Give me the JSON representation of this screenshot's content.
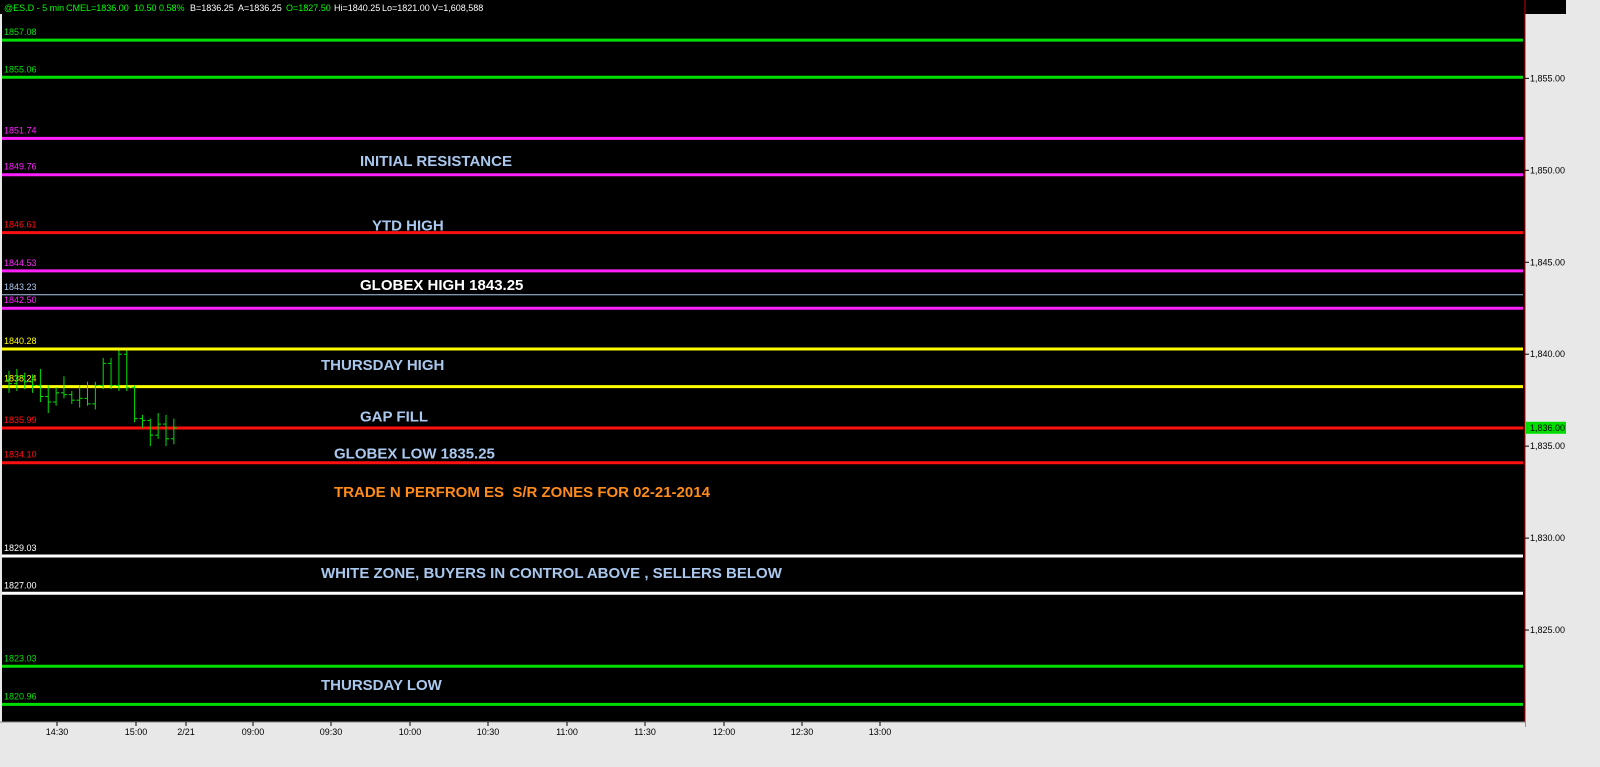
{
  "header": {
    "symbol": "@ES.D - 5 min",
    "exchange": "CME",
    "last": "L=1836.00",
    "change": "10.50",
    "change_pct": "0.58%",
    "bid": "B=1836.25",
    "ask": "A=1836.25",
    "open": "O=1827.50",
    "high": "Hi=1840.25",
    "low": "Lo=1821.00",
    "volume": "V=1,608,588"
  },
  "colors": {
    "background": "#000000",
    "green": "#00e000",
    "magenta": "#ff20ff",
    "red": "#ff1010",
    "yellow": "#ffff00",
    "white": "#ffffff",
    "light_blue": "#aac8ee",
    "orange": "#ff8c1a",
    "panel": "#e8e8e8",
    "last_price_box": "#00dd00"
  },
  "chart_data": {
    "type": "line",
    "title": "",
    "ylim": [
      1820,
      1858.5
    ],
    "y_ticks": [
      "1,855.00",
      "1,850.00",
      "1,845.00",
      "1,840.00",
      "1,835.00",
      "1,830.00",
      "1,825.00"
    ],
    "y_tick_values": [
      1855,
      1850,
      1845,
      1840,
      1835,
      1830,
      1825
    ],
    "x_ticks": [
      "14:30",
      "15:00",
      "2/21",
      "09:00",
      "09:30",
      "10:00",
      "10:30",
      "11:00",
      "11:30",
      "12:00",
      "12:30",
      "13:00"
    ],
    "last_price": "1,836.00",
    "last_price_value": 1836.0,
    "levels": [
      {
        "label": "1857.08",
        "value": 1857.08,
        "color": "green"
      },
      {
        "label": "1855.06",
        "value": 1855.06,
        "color": "green"
      },
      {
        "label": "1851.74",
        "value": 1851.74,
        "color": "magenta"
      },
      {
        "label": "1849.76",
        "value": 1849.76,
        "color": "magenta"
      },
      {
        "label": "1846.61",
        "value": 1846.61,
        "color": "red"
      },
      {
        "label": "1844.53",
        "value": 1844.53,
        "color": "magenta"
      },
      {
        "label": "1843.23",
        "value": 1843.23,
        "color": "light_blue"
      },
      {
        "label": "1842.50",
        "value": 1842.5,
        "color": "magenta"
      },
      {
        "label": "1840.28",
        "value": 1840.28,
        "color": "yellow"
      },
      {
        "label": "1838.24",
        "value": 1838.24,
        "color": "yellow"
      },
      {
        "label": "1835.99",
        "value": 1835.99,
        "color": "red"
      },
      {
        "label": "1834.10",
        "value": 1834.1,
        "color": "red"
      },
      {
        "label": "1829.03",
        "value": 1829.03,
        "color": "white"
      },
      {
        "label": "1827.00",
        "value": 1827.0,
        "color": "white"
      },
      {
        "label": "1823.03",
        "value": 1823.03,
        "color": "green"
      },
      {
        "label": "1820.96",
        "value": 1820.96,
        "color": "green"
      }
    ],
    "annotations": [
      {
        "text": "INITIAL RESISTANCE",
        "value": 1850.5,
        "color": "light_blue"
      },
      {
        "text": "YTD HIGH",
        "value": 1847.0,
        "color": "light_blue"
      },
      {
        "text": "GLOBEX HIGH 1843.25",
        "value": 1843.75,
        "color": "white"
      },
      {
        "text": "THURSDAY HIGH",
        "value": 1839.4,
        "color": "light_blue"
      },
      {
        "text": "GAP FILL",
        "value": 1836.6,
        "color": "light_blue"
      },
      {
        "text": "GLOBEX LOW 1835.25",
        "value": 1834.6,
        "color": "light_blue"
      },
      {
        "text": "TRADE N PERFROM ES  S/R ZONES FOR 02-21-2014",
        "value": 1832.5,
        "color": "orange"
      },
      {
        "text": "WHITE ZONE, BUYERS IN CONTROL ABOVE , SELLERS BELOW",
        "value": 1828.1,
        "color": "light_blue"
      },
      {
        "text": "THURSDAY LOW",
        "value": 1822.0,
        "color": "light_blue"
      }
    ],
    "bars": [
      {
        "o": 1838.6,
        "h": 1839.1,
        "l": 1837.9,
        "c": 1838.4
      },
      {
        "o": 1838.4,
        "h": 1839.2,
        "l": 1838.0,
        "c": 1838.8
      },
      {
        "o": 1838.8,
        "h": 1839.0,
        "l": 1838.1,
        "c": 1838.5
      },
      {
        "o": 1838.5,
        "h": 1838.9,
        "l": 1837.9,
        "c": 1838.3
      },
      {
        "o": 1838.3,
        "h": 1839.2,
        "l": 1837.4,
        "c": 1837.7
      },
      {
        "o": 1837.7,
        "h": 1838.3,
        "l": 1836.8,
        "c": 1837.4
      },
      {
        "o": 1837.4,
        "h": 1838.2,
        "l": 1837.2,
        "c": 1837.9
      },
      {
        "o": 1837.9,
        "h": 1838.8,
        "l": 1837.6,
        "c": 1837.8
      },
      {
        "o": 1837.8,
        "h": 1838.0,
        "l": 1837.3,
        "c": 1837.5
      },
      {
        "o": 1837.5,
        "h": 1838.3,
        "l": 1837.1,
        "c": 1837.6
      },
      {
        "o": 1837.6,
        "h": 1838.5,
        "l": 1837.2,
        "c": 1837.3
      },
      {
        "o": 1837.3,
        "h": 1838.5,
        "l": 1837.0,
        "c": 1838.3
      },
      {
        "o": 1838.3,
        "h": 1839.8,
        "l": 1838.1,
        "c": 1839.5
      },
      {
        "o": 1839.5,
        "h": 1839.8,
        "l": 1838.1,
        "c": 1838.3
      },
      {
        "o": 1838.3,
        "h": 1840.2,
        "l": 1838.0,
        "c": 1840.0
      },
      {
        "o": 1840.0,
        "h": 1840.2,
        "l": 1838.0,
        "c": 1838.2
      },
      {
        "o": 1838.2,
        "h": 1838.3,
        "l": 1836.3,
        "c": 1836.5
      },
      {
        "o": 1836.5,
        "h": 1836.7,
        "l": 1836.0,
        "c": 1836.4
      },
      {
        "o": 1836.4,
        "h": 1836.5,
        "l": 1835.0,
        "c": 1835.6
      },
      {
        "o": 1835.6,
        "h": 1836.8,
        "l": 1835.4,
        "c": 1836.2
      },
      {
        "o": 1836.2,
        "h": 1836.7,
        "l": 1835.0,
        "c": 1835.4
      },
      {
        "o": 1835.4,
        "h": 1836.5,
        "l": 1835.1,
        "c": 1836.0
      }
    ]
  }
}
